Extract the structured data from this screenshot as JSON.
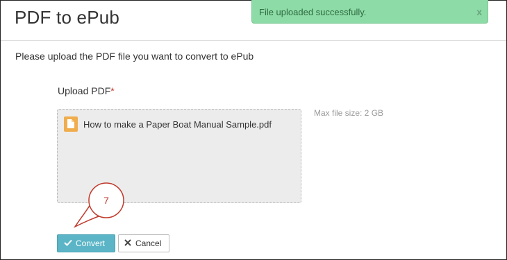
{
  "page": {
    "title": "PDF to ePub",
    "instruction": "Please upload the PDF file you want to convert to ePub"
  },
  "toast": {
    "message": "File uploaded successfully.",
    "close_label": "x"
  },
  "upload": {
    "label": "Upload PDF",
    "required_marker": "*",
    "file_name": "How to make a Paper Boat Manual Sample.pdf",
    "max_size": "Max file size: 2 GB"
  },
  "callout": {
    "number": "7"
  },
  "actions": {
    "convert_label": "Convert",
    "cancel_label": "Cancel"
  },
  "colors": {
    "toast_bg": "#8ddba6",
    "convert_bg": "#5bb5c6",
    "file_icon": "#f0ad4e",
    "required": "#c0392b",
    "callout_stroke": "#c0392b"
  }
}
